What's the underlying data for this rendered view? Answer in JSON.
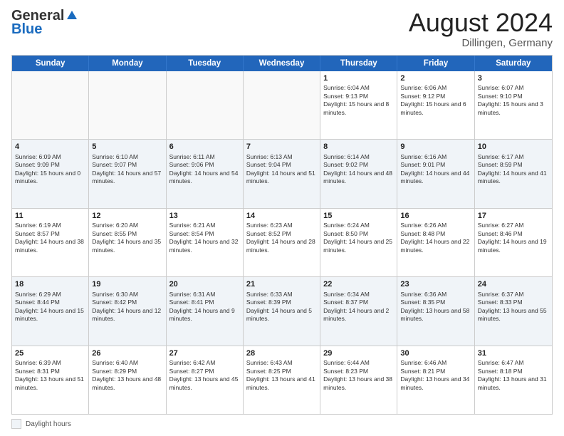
{
  "logo": {
    "general": "General",
    "blue": "Blue"
  },
  "header": {
    "month_year": "August 2024",
    "location": "Dillingen, Germany"
  },
  "days_of_week": [
    "Sunday",
    "Monday",
    "Tuesday",
    "Wednesday",
    "Thursday",
    "Friday",
    "Saturday"
  ],
  "footer": {
    "label": "Daylight hours"
  },
  "weeks": [
    {
      "cells": [
        {
          "day": "",
          "info": ""
        },
        {
          "day": "",
          "info": ""
        },
        {
          "day": "",
          "info": ""
        },
        {
          "day": "",
          "info": ""
        },
        {
          "day": "1",
          "info": "Sunrise: 6:04 AM\nSunset: 9:13 PM\nDaylight: 15 hours and 8 minutes."
        },
        {
          "day": "2",
          "info": "Sunrise: 6:06 AM\nSunset: 9:12 PM\nDaylight: 15 hours and 6 minutes."
        },
        {
          "day": "3",
          "info": "Sunrise: 6:07 AM\nSunset: 9:10 PM\nDaylight: 15 hours and 3 minutes."
        }
      ]
    },
    {
      "cells": [
        {
          "day": "4",
          "info": "Sunrise: 6:09 AM\nSunset: 9:09 PM\nDaylight: 15 hours and 0 minutes."
        },
        {
          "day": "5",
          "info": "Sunrise: 6:10 AM\nSunset: 9:07 PM\nDaylight: 14 hours and 57 minutes."
        },
        {
          "day": "6",
          "info": "Sunrise: 6:11 AM\nSunset: 9:06 PM\nDaylight: 14 hours and 54 minutes."
        },
        {
          "day": "7",
          "info": "Sunrise: 6:13 AM\nSunset: 9:04 PM\nDaylight: 14 hours and 51 minutes."
        },
        {
          "day": "8",
          "info": "Sunrise: 6:14 AM\nSunset: 9:02 PM\nDaylight: 14 hours and 48 minutes."
        },
        {
          "day": "9",
          "info": "Sunrise: 6:16 AM\nSunset: 9:01 PM\nDaylight: 14 hours and 44 minutes."
        },
        {
          "day": "10",
          "info": "Sunrise: 6:17 AM\nSunset: 8:59 PM\nDaylight: 14 hours and 41 minutes."
        }
      ]
    },
    {
      "cells": [
        {
          "day": "11",
          "info": "Sunrise: 6:19 AM\nSunset: 8:57 PM\nDaylight: 14 hours and 38 minutes."
        },
        {
          "day": "12",
          "info": "Sunrise: 6:20 AM\nSunset: 8:55 PM\nDaylight: 14 hours and 35 minutes."
        },
        {
          "day": "13",
          "info": "Sunrise: 6:21 AM\nSunset: 8:54 PM\nDaylight: 14 hours and 32 minutes."
        },
        {
          "day": "14",
          "info": "Sunrise: 6:23 AM\nSunset: 8:52 PM\nDaylight: 14 hours and 28 minutes."
        },
        {
          "day": "15",
          "info": "Sunrise: 6:24 AM\nSunset: 8:50 PM\nDaylight: 14 hours and 25 minutes."
        },
        {
          "day": "16",
          "info": "Sunrise: 6:26 AM\nSunset: 8:48 PM\nDaylight: 14 hours and 22 minutes."
        },
        {
          "day": "17",
          "info": "Sunrise: 6:27 AM\nSunset: 8:46 PM\nDaylight: 14 hours and 19 minutes."
        }
      ]
    },
    {
      "cells": [
        {
          "day": "18",
          "info": "Sunrise: 6:29 AM\nSunset: 8:44 PM\nDaylight: 14 hours and 15 minutes."
        },
        {
          "day": "19",
          "info": "Sunrise: 6:30 AM\nSunset: 8:42 PM\nDaylight: 14 hours and 12 minutes."
        },
        {
          "day": "20",
          "info": "Sunrise: 6:31 AM\nSunset: 8:41 PM\nDaylight: 14 hours and 9 minutes."
        },
        {
          "day": "21",
          "info": "Sunrise: 6:33 AM\nSunset: 8:39 PM\nDaylight: 14 hours and 5 minutes."
        },
        {
          "day": "22",
          "info": "Sunrise: 6:34 AM\nSunset: 8:37 PM\nDaylight: 14 hours and 2 minutes."
        },
        {
          "day": "23",
          "info": "Sunrise: 6:36 AM\nSunset: 8:35 PM\nDaylight: 13 hours and 58 minutes."
        },
        {
          "day": "24",
          "info": "Sunrise: 6:37 AM\nSunset: 8:33 PM\nDaylight: 13 hours and 55 minutes."
        }
      ]
    },
    {
      "cells": [
        {
          "day": "25",
          "info": "Sunrise: 6:39 AM\nSunset: 8:31 PM\nDaylight: 13 hours and 51 minutes."
        },
        {
          "day": "26",
          "info": "Sunrise: 6:40 AM\nSunset: 8:29 PM\nDaylight: 13 hours and 48 minutes."
        },
        {
          "day": "27",
          "info": "Sunrise: 6:42 AM\nSunset: 8:27 PM\nDaylight: 13 hours and 45 minutes."
        },
        {
          "day": "28",
          "info": "Sunrise: 6:43 AM\nSunset: 8:25 PM\nDaylight: 13 hours and 41 minutes."
        },
        {
          "day": "29",
          "info": "Sunrise: 6:44 AM\nSunset: 8:23 PM\nDaylight: 13 hours and 38 minutes."
        },
        {
          "day": "30",
          "info": "Sunrise: 6:46 AM\nSunset: 8:21 PM\nDaylight: 13 hours and 34 minutes."
        },
        {
          "day": "31",
          "info": "Sunrise: 6:47 AM\nSunset: 8:18 PM\nDaylight: 13 hours and 31 minutes."
        }
      ]
    }
  ]
}
